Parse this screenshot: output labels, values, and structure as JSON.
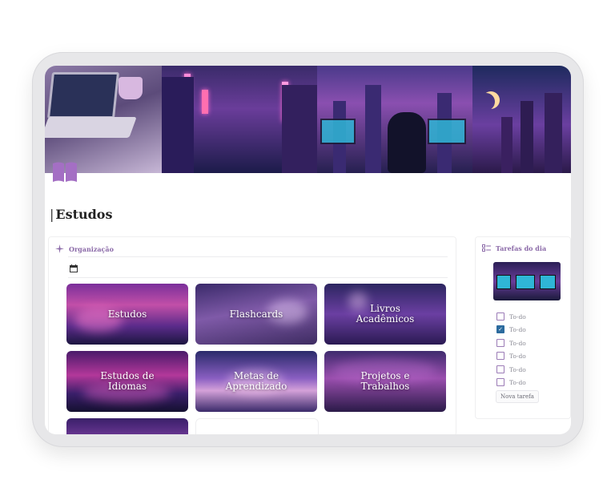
{
  "page": {
    "title": "Estudos",
    "title_prefix": "|"
  },
  "left_panel": {
    "header": "Organização",
    "header_icon": "sparkle-icon",
    "view_icon": "calendar-icon",
    "cards": [
      {
        "label_lines": [
          "Estudos"
        ]
      },
      {
        "label_lines": [
          "Flashcards"
        ]
      },
      {
        "label_lines": [
          "Livros",
          "Acadêmicos"
        ]
      },
      {
        "label_lines": [
          "Estudos de",
          "Idiomas"
        ]
      },
      {
        "label_lines": [
          "Metas de",
          "Aprendizado"
        ]
      },
      {
        "label_lines": [
          "Projetos e",
          "Trabalhos"
        ]
      }
    ]
  },
  "right_panel": {
    "header": "Tarefas do dia",
    "header_icon": "checklist-icon",
    "todos": [
      {
        "label": "To-do",
        "checked": false
      },
      {
        "label": "To-do",
        "checked": true
      },
      {
        "label": "To-do",
        "checked": false
      },
      {
        "label": "To-do",
        "checked": false
      },
      {
        "label": "To-do",
        "checked": false
      },
      {
        "label": "To-do",
        "checked": false
      }
    ],
    "new_task_label": "Nova tarefa"
  },
  "colors": {
    "accent": "#8b6aa8",
    "check": "#2c6b9e",
    "icon": "#a46fc4"
  }
}
